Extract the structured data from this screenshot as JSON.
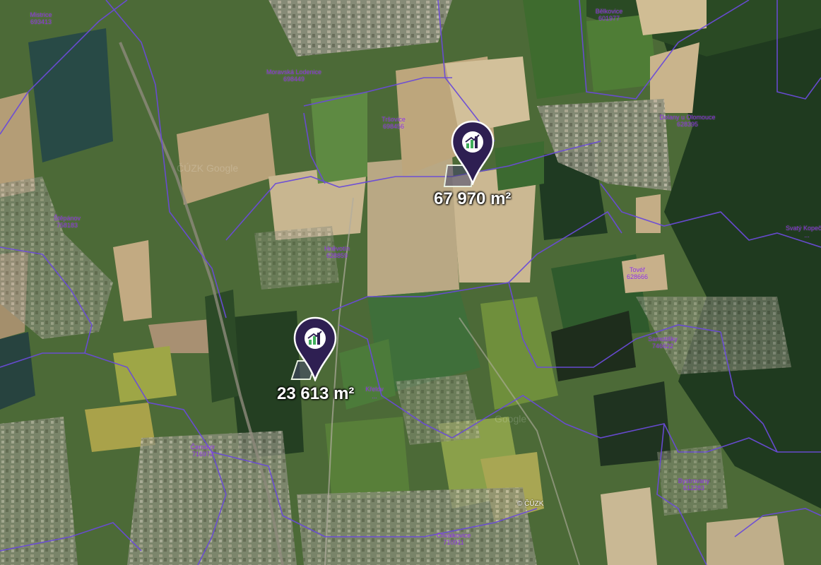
{
  "colors": {
    "marker": "#2e1f52",
    "boundary": "#6a4bd8",
    "place_label": "#8a2be2",
    "area_label": "#ffffff"
  },
  "places": [
    {
      "name": "Mistrice",
      "code": "693413"
    },
    {
      "name": "Bělkovice",
      "code": "601977"
    },
    {
      "name": "Moravská Lodenice",
      "code": "698449"
    },
    {
      "name": "Tršovice",
      "code": "698456"
    },
    {
      "name": "Dolany u Olomouce",
      "code": "628395"
    },
    {
      "name": "Štěpánov",
      "code": "758183"
    },
    {
      "name": "Svatý Kopeček",
      "code": "..."
    },
    {
      "name": "Hněvotín",
      "code": "628859"
    },
    {
      "name": "Tovéř",
      "code": "628666"
    },
    {
      "name": "Samotišky",
      "code": "746622"
    },
    {
      "name": "Černovír",
      "code": "716973"
    },
    {
      "name": "Bystrovany",
      "code": "612283"
    },
    {
      "name": "Chválkovice",
      "code": "710911"
    },
    {
      "name": "Křelov",
      "code": "..."
    }
  ],
  "markers": [
    {
      "icon": "chart-logo-icon",
      "area": "67 970 m²"
    },
    {
      "icon": "chart-logo-icon",
      "area": "23 613 m²"
    }
  ],
  "copyright": "© ČÚZK",
  "watermarks": [
    "ČÚZK Google",
    "Google"
  ]
}
